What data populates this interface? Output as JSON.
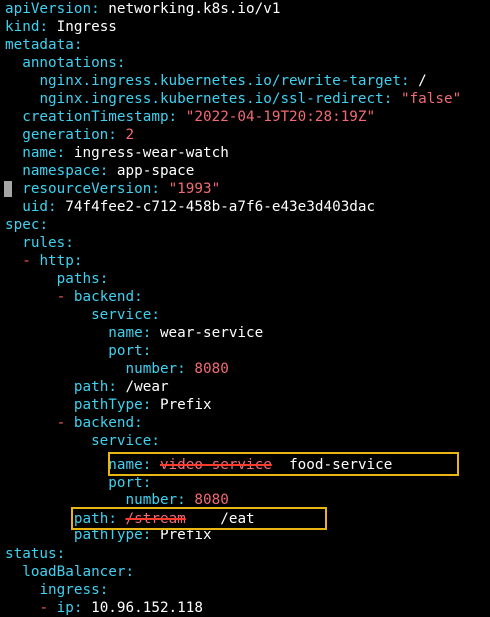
{
  "yaml": {
    "apiVersion": {
      "key": "apiVersion",
      "sep": ": ",
      "value": "networking.k8s.io/v1"
    },
    "kind": {
      "key": "kind",
      "sep": ": ",
      "value": "Ingress"
    },
    "metadata": {
      "key": "metadata",
      "sep": ":"
    },
    "annotations": {
      "key": "annotations",
      "sep": ":"
    },
    "rewrite_target": {
      "key": "nginx.ingress.kubernetes.io/rewrite-target",
      "sep": ": ",
      "value": "/"
    },
    "ssl_redirect": {
      "key": "nginx.ingress.kubernetes.io/ssl-redirect",
      "sep": ": ",
      "value": "\"false\""
    },
    "creationTimestamp": {
      "key": "creationTimestamp",
      "sep": ": ",
      "value": "\"2022-04-19T20:28:19Z\""
    },
    "generation": {
      "key": "generation",
      "sep": ": ",
      "value": "2"
    },
    "name": {
      "key": "name",
      "sep": ": ",
      "value": "ingress-wear-watch"
    },
    "namespace": {
      "key": "namespace",
      "sep": ": ",
      "value": "app-space"
    },
    "resourceVersion": {
      "key": "resourceVersion",
      "sep": ": ",
      "value": "\"1993\""
    },
    "uid": {
      "key": "uid",
      "sep": ": ",
      "value": "74f4fee2-c712-458b-a7f6-e43e3d403dac"
    },
    "spec": {
      "key": "spec",
      "sep": ":"
    },
    "rules": {
      "key": "rules",
      "sep": ":"
    },
    "http": {
      "dash": "-",
      "key": "http",
      "sep": ":"
    },
    "paths": {
      "key": "paths",
      "sep": ":"
    },
    "backend1": {
      "dash": "-",
      "key": "backend",
      "sep": ":"
    },
    "service1": {
      "key": "service",
      "sep": ":"
    },
    "service1_name": {
      "key": "name",
      "sep": ": ",
      "value": "wear-service"
    },
    "service1_port": {
      "key": "port",
      "sep": ":"
    },
    "service1_number": {
      "key": "number",
      "sep": ": ",
      "value": "8080"
    },
    "path1": {
      "key": "path",
      "sep": ": ",
      "value": "/wear"
    },
    "pathType1": {
      "key": "pathType",
      "sep": ": ",
      "value": "Prefix"
    },
    "backend2": {
      "dash": "-",
      "key": "backend",
      "sep": ":"
    },
    "service2": {
      "key": "service",
      "sep": ":"
    },
    "service2_name": {
      "key": "name",
      "sep": ": ",
      "old_value": "video-service",
      "new_value": "food-service"
    },
    "service2_port": {
      "key": "port",
      "sep": ":"
    },
    "service2_number": {
      "key": "number",
      "sep": ": ",
      "value": "8080"
    },
    "path2": {
      "key": "path",
      "sep": ": ",
      "old_value": "/stream",
      "new_value": "/eat"
    },
    "pathType2": {
      "key": "pathType",
      "sep": ": ",
      "value": "Prefix"
    },
    "status": {
      "key": "status",
      "sep": ":"
    },
    "loadBalancer": {
      "key": "loadBalancer",
      "sep": ":"
    },
    "ingress": {
      "key": "ingress",
      "sep": ":"
    },
    "ip": {
      "dash": "-",
      "key": "ip",
      "sep": ": ",
      "value": "10.96.152.118"
    }
  },
  "colors": {
    "key": "#3fd1f0",
    "plain_value": "#ffffff",
    "string_value": "#f36a74",
    "highlight_box": "#e8b512",
    "strike": "#ff3b2f",
    "background": "#000000"
  }
}
